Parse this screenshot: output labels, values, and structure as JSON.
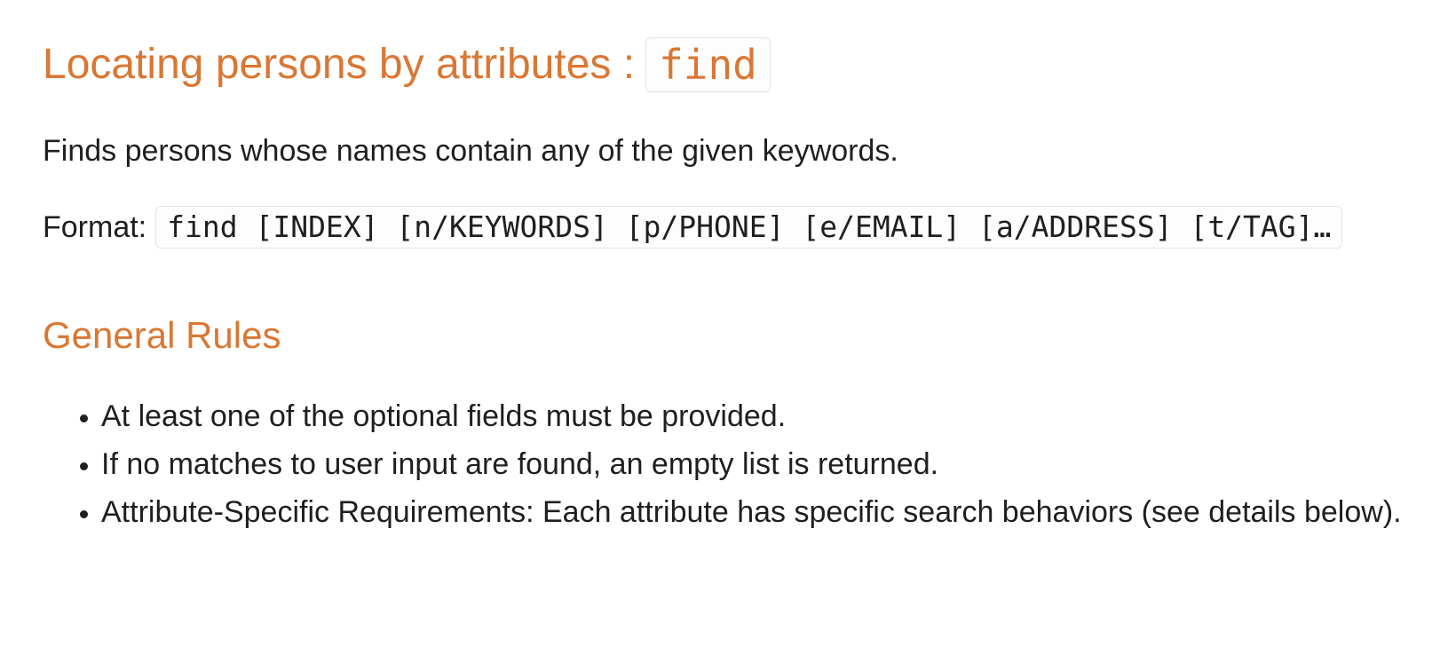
{
  "heading": {
    "text": "Locating persons by attributes :",
    "command": "find"
  },
  "description": "Finds persons whose names contain any of the given keywords.",
  "format": {
    "label": "Format:",
    "code": "find [INDEX] [n/KEYWORDS] [p/PHONE] [e/EMAIL] [a/ADDRESS] [t/TAG]…"
  },
  "general_rules": {
    "title": "General Rules",
    "items": [
      "At least one of the optional fields must be provided.",
      "If no matches to user input are found, an empty list is returned.",
      "Attribute-Specific Requirements: Each attribute has specific search behaviors (see details below)."
    ]
  },
  "colors": {
    "heading": "#d97733",
    "text": "#1f1f1f",
    "code_border": "#e3e3e3"
  }
}
